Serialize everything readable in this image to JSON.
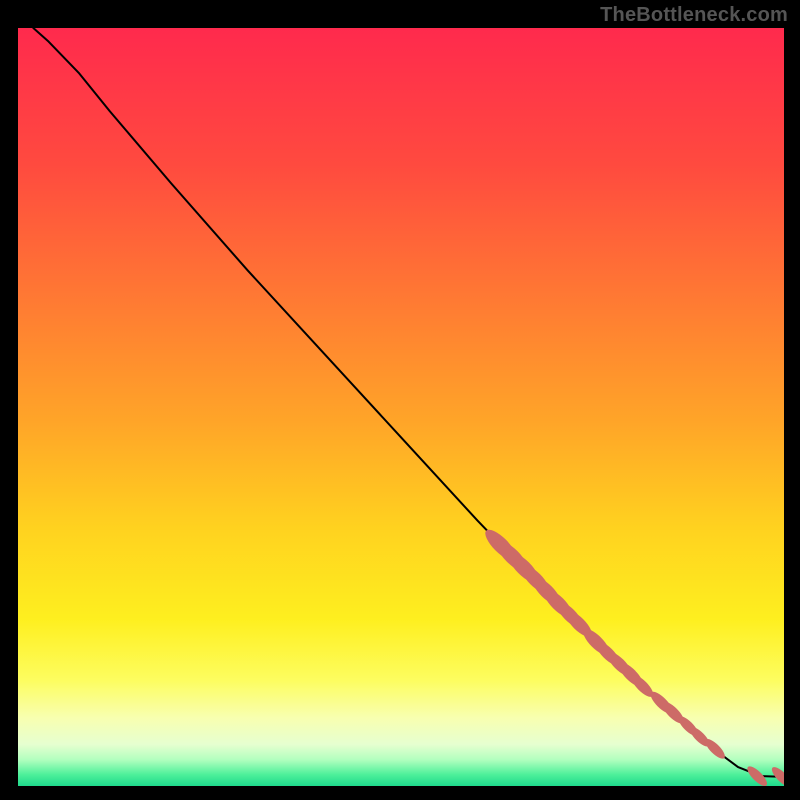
{
  "watermark": "TheBottleneck.com",
  "chart_data": {
    "type": "line",
    "title": "",
    "xlabel": "",
    "ylabel": "",
    "xlim": [
      0,
      100
    ],
    "ylim": [
      0,
      100
    ],
    "grid": false,
    "legend": false,
    "background_gradient": {
      "stops": [
        {
          "offset": 0.0,
          "color": "#ff2a4d"
        },
        {
          "offset": 0.18,
          "color": "#ff4a3f"
        },
        {
          "offset": 0.36,
          "color": "#ff7a33"
        },
        {
          "offset": 0.52,
          "color": "#ffa528"
        },
        {
          "offset": 0.66,
          "color": "#ffd21f"
        },
        {
          "offset": 0.78,
          "color": "#feef1f"
        },
        {
          "offset": 0.86,
          "color": "#fdfd5f"
        },
        {
          "offset": 0.91,
          "color": "#f8ffb0"
        },
        {
          "offset": 0.945,
          "color": "#e6ffd0"
        },
        {
          "offset": 0.965,
          "color": "#b3ffbf"
        },
        {
          "offset": 0.985,
          "color": "#4df09a"
        },
        {
          "offset": 1.0,
          "color": "#1fd98c"
        }
      ]
    },
    "curve": [
      {
        "x": 2.0,
        "y": 100.0
      },
      {
        "x": 4.0,
        "y": 98.2
      },
      {
        "x": 8.0,
        "y": 94.0
      },
      {
        "x": 12.0,
        "y": 89.0
      },
      {
        "x": 20.0,
        "y": 79.5
      },
      {
        "x": 30.0,
        "y": 68.0
      },
      {
        "x": 40.0,
        "y": 57.0
      },
      {
        "x": 50.0,
        "y": 46.0
      },
      {
        "x": 60.0,
        "y": 35.0
      },
      {
        "x": 70.0,
        "y": 24.5
      },
      {
        "x": 78.0,
        "y": 16.5
      },
      {
        "x": 84.0,
        "y": 11.0
      },
      {
        "x": 90.0,
        "y": 5.5
      },
      {
        "x": 94.0,
        "y": 2.5
      },
      {
        "x": 97.0,
        "y": 1.3
      },
      {
        "x": 100.0,
        "y": 1.2
      }
    ],
    "markers": [
      {
        "x": 63.0,
        "y": 31.8,
        "r": 1.4
      },
      {
        "x": 64.5,
        "y": 30.3,
        "r": 1.4
      },
      {
        "x": 66.0,
        "y": 28.8,
        "r": 1.4
      },
      {
        "x": 67.5,
        "y": 27.3,
        "r": 1.3
      },
      {
        "x": 69.0,
        "y": 25.7,
        "r": 1.3
      },
      {
        "x": 70.5,
        "y": 24.1,
        "r": 1.3
      },
      {
        "x": 72.0,
        "y": 22.6,
        "r": 1.2
      },
      {
        "x": 73.2,
        "y": 21.4,
        "r": 1.2
      },
      {
        "x": 75.5,
        "y": 19.0,
        "r": 1.2
      },
      {
        "x": 77.0,
        "y": 17.5,
        "r": 1.1
      },
      {
        "x": 78.5,
        "y": 16.1,
        "r": 1.1
      },
      {
        "x": 80.0,
        "y": 14.7,
        "r": 1.1
      },
      {
        "x": 81.5,
        "y": 13.2,
        "r": 1.0
      },
      {
        "x": 84.0,
        "y": 11.0,
        "r": 1.0
      },
      {
        "x": 85.5,
        "y": 9.7,
        "r": 1.0
      },
      {
        "x": 87.5,
        "y": 7.9,
        "r": 0.9
      },
      {
        "x": 89.0,
        "y": 6.5,
        "r": 0.9
      },
      {
        "x": 91.0,
        "y": 4.9,
        "r": 0.9
      },
      {
        "x": 96.5,
        "y": 1.3,
        "r": 0.9
      },
      {
        "x": 99.7,
        "y": 1.2,
        "r": 0.9
      }
    ]
  }
}
